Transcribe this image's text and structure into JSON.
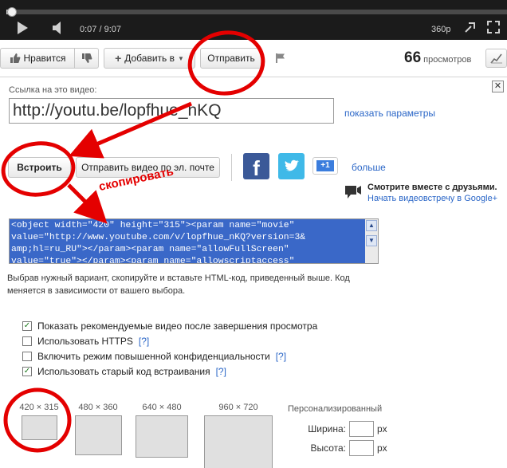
{
  "player": {
    "time": "0:07 / 9:07",
    "quality": "360p",
    "progress_fraction": 0.013
  },
  "actions": {
    "like_label": "Нравится",
    "add_label": "Добавить в",
    "share_label": "Отправить",
    "views_count": "66",
    "views_label": "просмотров"
  },
  "share": {
    "link_label": "Ссылка на это видео:",
    "link_value": "http://youtu.be/lopfhue_nKQ",
    "show_params": "показать параметры",
    "embed_label": "Встроить",
    "email_label": "Отправить видео по эл. почте",
    "gplus_label": "+1",
    "more_label": "больше",
    "hangout_title": "Смотрите вместе с друзьями.",
    "hangout_link": "Начать видеовстречу в Google+",
    "embed_code": "<object width=\"420\" height=\"315\"><param name=\"movie\"\nvalue=\"http://www.youtube.com/v/lopfhue_nKQ?version=3&\namp;hl=ru_RU\"></param><param name=\"allowFullScreen\"\nvalue=\"true\"></param><param name=\"allowscriptaccess\"",
    "help_text": "Выбрав нужный вариант, скопируйте и вставьте HTML-код, приведенный выше. Код меняется в зависимости от вашего выбора."
  },
  "options": [
    {
      "label": "Показать рекомендуемые видео после завершения просмотра",
      "checked": true,
      "link": ""
    },
    {
      "label": "Использовать HTTPS",
      "checked": false,
      "link": "[?]"
    },
    {
      "label": "Включить режим повышенной конфиденциальности",
      "checked": false,
      "link": "[?]"
    },
    {
      "label": "Использовать старый код встраивания",
      "checked": true,
      "link": "[?]"
    }
  ],
  "sizes": [
    "420 × 315",
    "480 × 360",
    "640 × 480",
    "960 × 720"
  ],
  "custom": {
    "title": "Персонализированный",
    "width_label": "Ширина:",
    "height_label": "Высота:",
    "unit": "px"
  },
  "annotation": {
    "text": "скопировать",
    "color": "#e40000"
  },
  "colors": {
    "link": "#2a66c7",
    "selection": "#3a68c8",
    "facebook": "#3b5998",
    "twitter": "#3fb9e8"
  },
  "icons": [
    "play-icon",
    "volume-icon",
    "popout-icon",
    "fullscreen-icon",
    "thumb-up-icon",
    "thumb-down-icon",
    "plus-icon",
    "chevron-down-icon",
    "flag-icon",
    "stats-icon",
    "close-icon",
    "facebook-icon",
    "twitter-icon",
    "hangout-icon"
  ]
}
